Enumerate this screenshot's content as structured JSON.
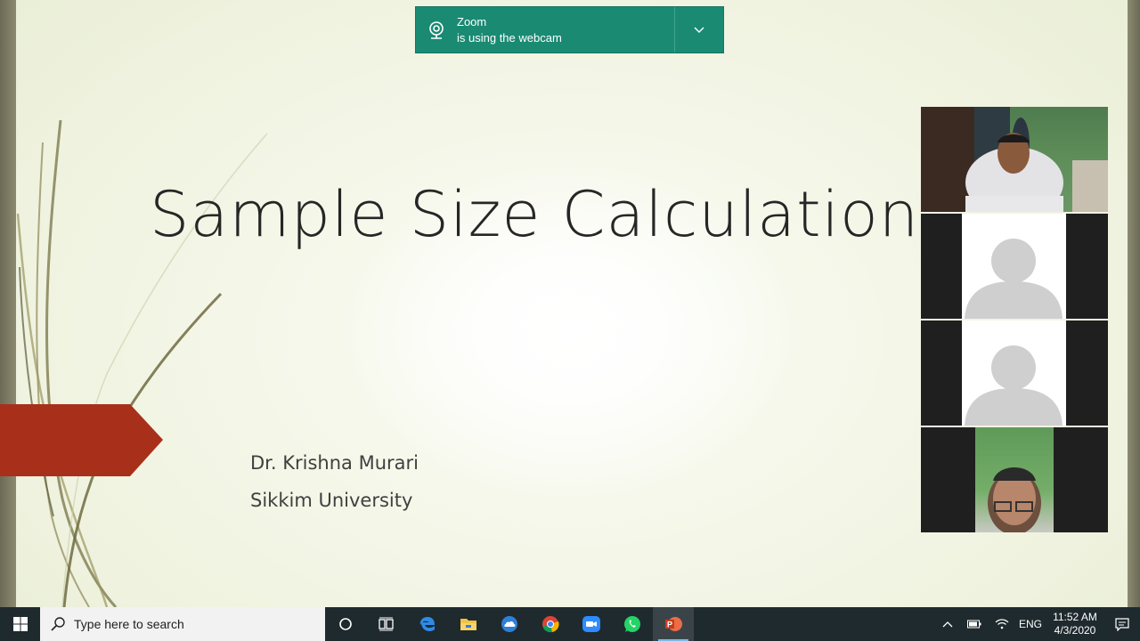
{
  "notification": {
    "app": "Zoom",
    "message": "is using the webcam",
    "icon": "webcam-icon",
    "expand_icon": "chevron-down-icon",
    "color": "#1a8a73"
  },
  "slide": {
    "title": "Sample Size Calculation",
    "author": "Dr. Krishna Murari",
    "affiliation": "Sikkim University",
    "accent_color": "#a8301a"
  },
  "participants": [
    {
      "type": "camera",
      "label": "participant-video-1"
    },
    {
      "type": "avatar",
      "label": "participant-avatar-2"
    },
    {
      "type": "avatar",
      "label": "participant-avatar-3"
    },
    {
      "type": "camera",
      "label": "participant-video-4"
    }
  ],
  "taskbar": {
    "search_placeholder": "Type here to search",
    "apps": [
      "cortana-icon",
      "task-view-icon",
      "edge-icon",
      "file-explorer-icon",
      "cloud-icon",
      "chrome-icon",
      "zoom-icon",
      "whatsapp-icon",
      "powerpoint-icon"
    ],
    "active_app": "powerpoint-icon",
    "language": "ENG",
    "time": "11:52 AM",
    "date": "4/3/2020"
  }
}
